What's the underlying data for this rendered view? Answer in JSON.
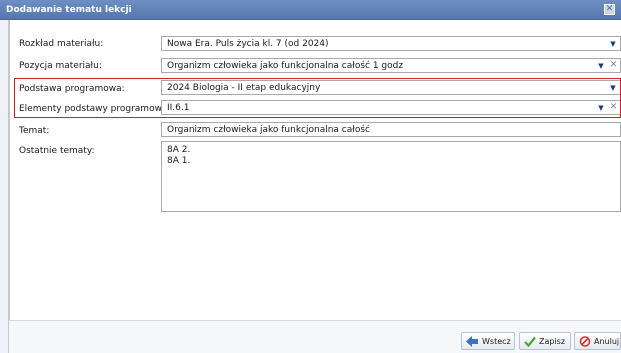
{
  "window": {
    "title": "Dodawanie tematu lekcji"
  },
  "form": {
    "rozklad": {
      "label": "Rozkład materiału:",
      "value": "Nowa Era. Puls życia kl. 7 (od 2024)"
    },
    "pozycja": {
      "label": "Pozycja materiału:",
      "value": "Organizm człowieka jako funkcjonalna całość 1 godz"
    },
    "podstawa": {
      "label": "Podstawa programowa:",
      "value": "2024 Biologia - II etap edukacyjny"
    },
    "elementy": {
      "label": "Elementy podstawy programowej:",
      "value": "II.6.1"
    },
    "temat": {
      "label": "Temat:",
      "value": "Organizm człowieka jako funkcjonalna całość"
    },
    "ostatnie": {
      "label": "Ostatnie tematy:",
      "lines": [
        "8A 2.",
        "8A 1."
      ]
    }
  },
  "footer": {
    "back_label": "Wstecz",
    "save_label": "Zapisz",
    "cancel_label": "Anuluj"
  },
  "colors": {
    "titlebar": "#5f82bb",
    "highlight_border": "#d0202a",
    "save_icon": "#4aa52e",
    "cancel_icon": "#d9342b",
    "back_icon": "#3b73c4"
  }
}
